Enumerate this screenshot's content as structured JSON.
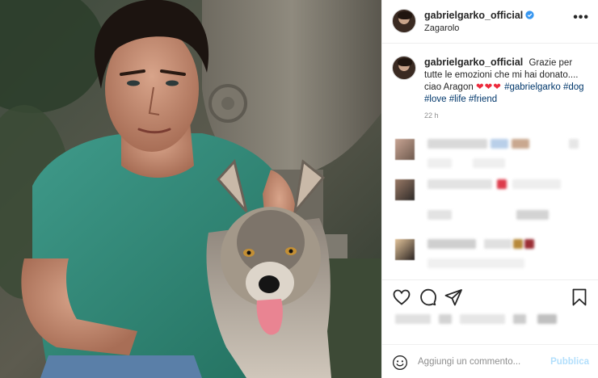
{
  "post": {
    "username": "gabrielgarko_official",
    "location": "Zagarolo",
    "more_label": "•••",
    "caption": {
      "username": "gabrielgarko_official",
      "text_start": "Grazie per tutte le emozioni che mi hai donato.... ciao Aragon",
      "hearts": "❤❤❤",
      "tags": [
        "#gabrielgarko",
        "#dog",
        "#love",
        "#life",
        "#friend"
      ],
      "time": "22 h"
    },
    "comment_box": {
      "placeholder": "Aggiungi un commento...",
      "publish_label": "Pubblica"
    },
    "icons": {
      "verified": "verified-badge-icon",
      "like": "heart-icon",
      "comment": "comment-bubble-icon",
      "share": "paper-plane-icon",
      "save": "bookmark-icon",
      "emoji": "smiley-icon"
    },
    "colors": {
      "verified": "#3897f0",
      "hashtag": "#00376b",
      "publish_disabled": "#b2dffc",
      "heart": "#ed2b3c"
    }
  }
}
